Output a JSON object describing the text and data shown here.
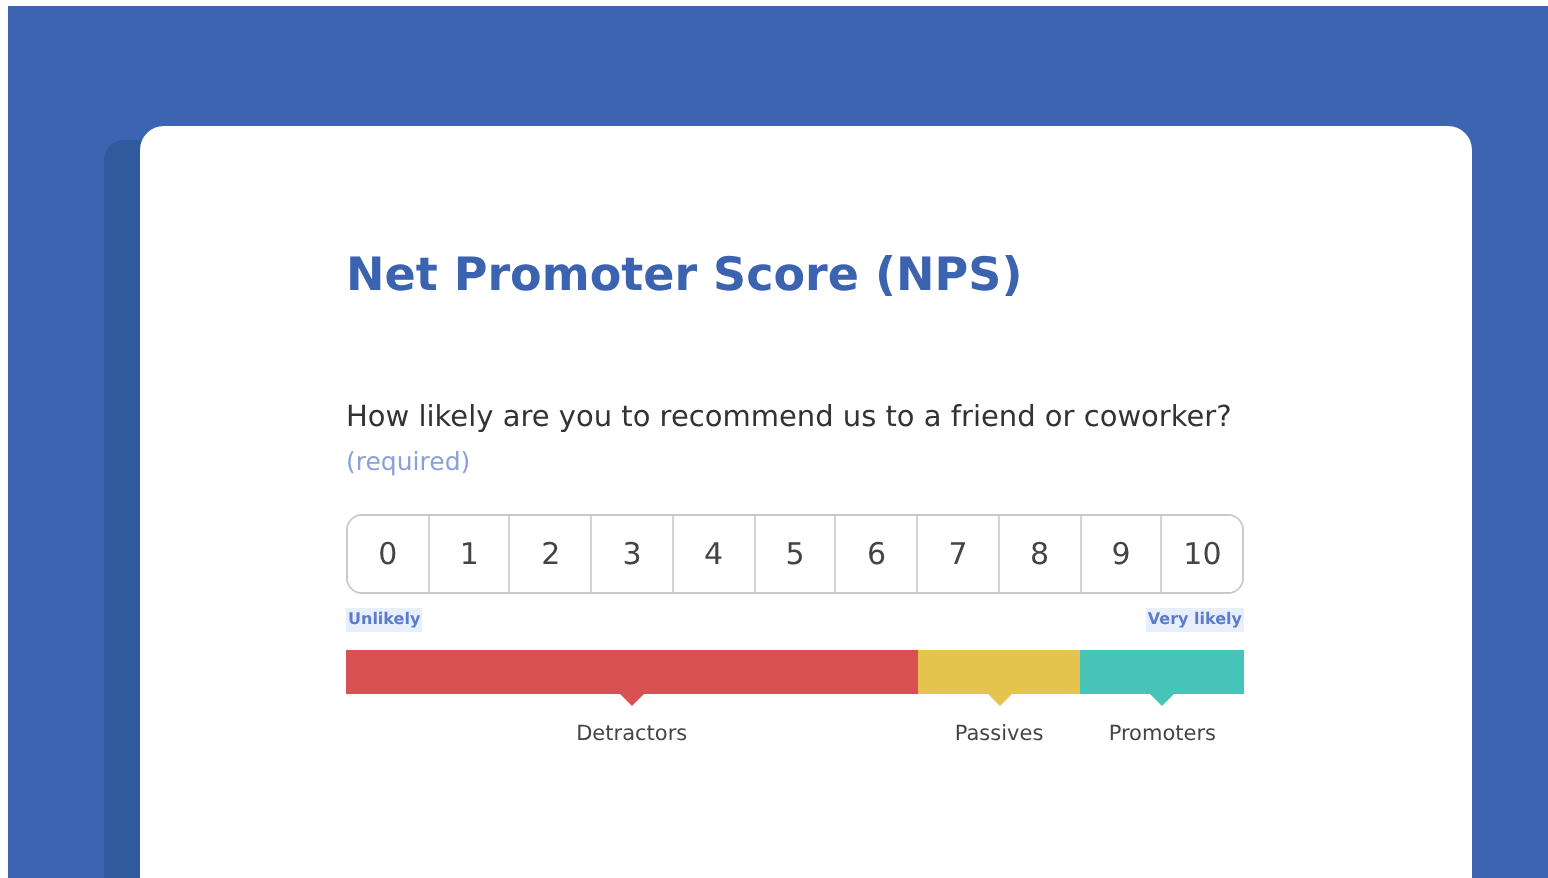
{
  "title": "Net Promoter Score (NPS)",
  "question": "How likely are you to recommend us to a friend or coworker?",
  "required_note": "(required)",
  "scale_low_label": "Unlikely",
  "scale_high_label": "Very likely",
  "segments": [
    {
      "label": "Detractors",
      "color": "#d95052",
      "options": [
        {
          "label": "0",
          "selected": false
        },
        {
          "label": "1",
          "selected": false
        },
        {
          "label": "2",
          "selected": false
        },
        {
          "label": "3",
          "selected": false
        },
        {
          "label": "4",
          "selected": false
        },
        {
          "label": "5",
          "selected": false
        },
        {
          "label": "6",
          "selected": false
        }
      ]
    },
    {
      "label": "Passives",
      "color": "#e4c44f",
      "options": [
        {
          "label": "7",
          "selected": false
        },
        {
          "label": "8",
          "selected": false
        }
      ]
    },
    {
      "label": "Promoters",
      "color": "#47c4b8",
      "options": [
        {
          "label": "9",
          "selected": false
        },
        {
          "label": "10",
          "selected": false
        }
      ]
    }
  ]
}
